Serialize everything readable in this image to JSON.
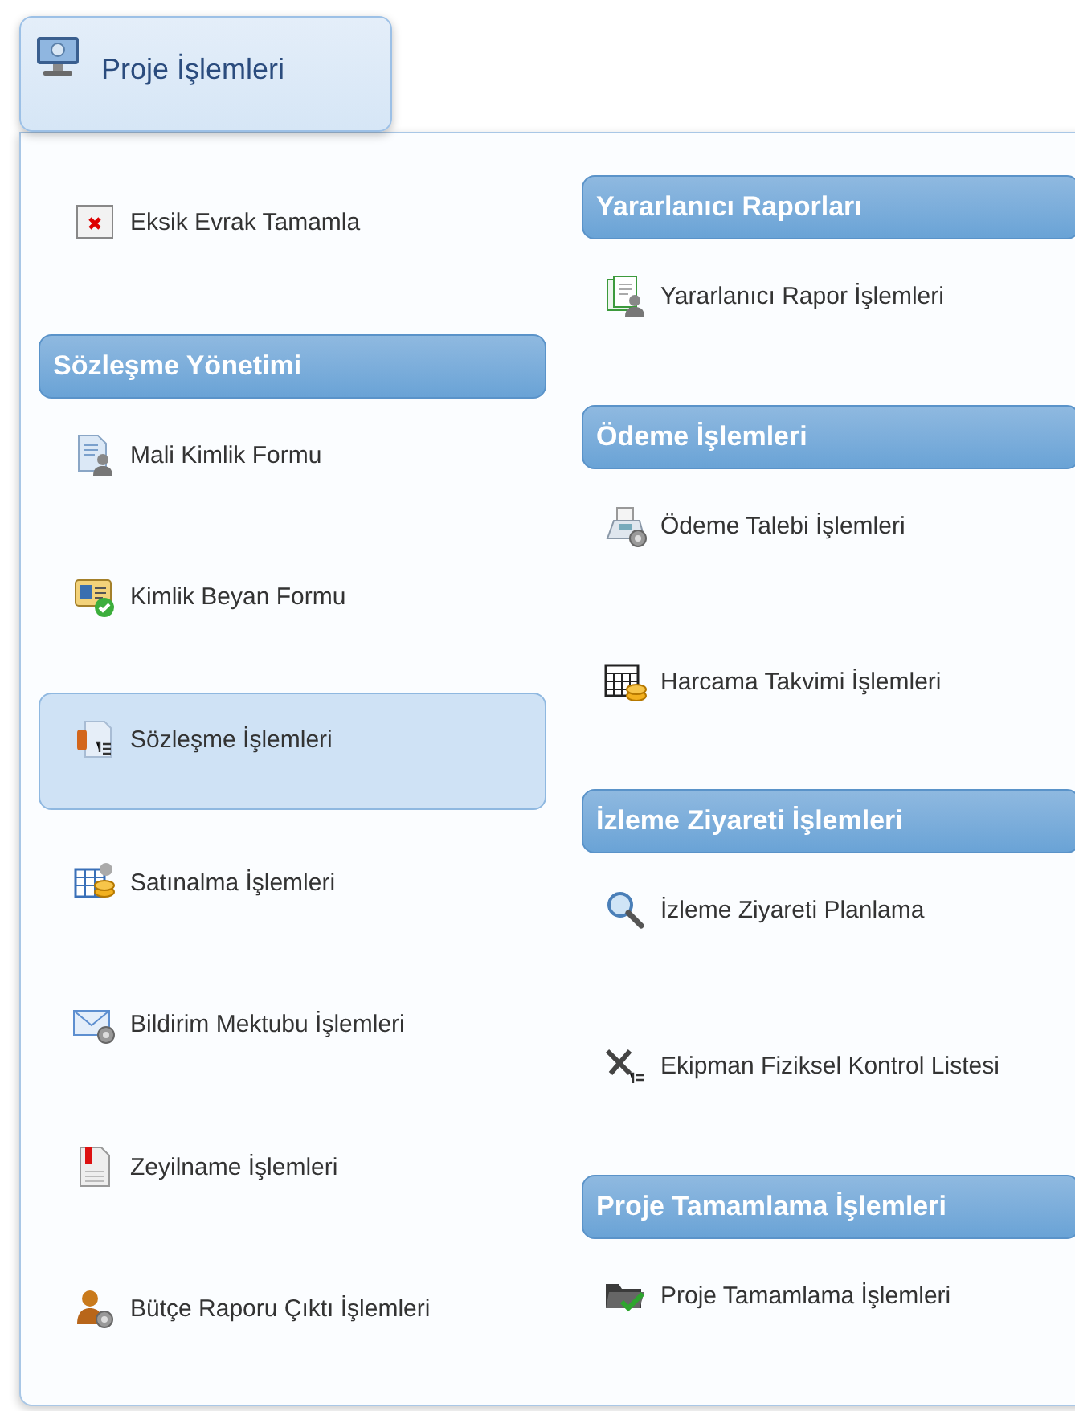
{
  "tab": {
    "label": "Proje İşlemleri"
  },
  "columns": [
    {
      "entries": [
        {
          "kind": "item",
          "label": "Eksik Evrak Tamamla",
          "selected": false
        },
        {
          "kind": "header",
          "label": "Sözleşme Yönetimi"
        },
        {
          "kind": "item",
          "label": "Mali Kimlik Formu",
          "selected": false
        },
        {
          "kind": "item",
          "label": "Kimlik Beyan Formu",
          "selected": false
        },
        {
          "kind": "item",
          "label": "Sözleşme İşlemleri",
          "selected": true
        },
        {
          "kind": "item",
          "label": "Satınalma İşlemleri",
          "selected": false
        },
        {
          "kind": "item",
          "label": "Bildirim Mektubu İşlemleri",
          "selected": false
        },
        {
          "kind": "item",
          "label": "Zeyilname İşlemleri",
          "selected": false
        },
        {
          "kind": "item",
          "label": "Bütçe Raporu Çıktı İşlemleri",
          "selected": false
        }
      ]
    },
    {
      "entries": [
        {
          "kind": "header",
          "label": "Yararlanıcı Raporları"
        },
        {
          "kind": "item",
          "label": "Yararlanıcı Rapor İşlemleri",
          "selected": false
        },
        {
          "kind": "header",
          "label": "Ödeme İşlemleri"
        },
        {
          "kind": "item",
          "label": "Ödeme Talebi İşlemleri",
          "selected": false
        },
        {
          "kind": "item",
          "label": "Harcama Takvimi İşlemleri",
          "selected": false
        },
        {
          "kind": "header",
          "label": "İzleme Ziyareti İşlemleri"
        },
        {
          "kind": "item",
          "label": "İzleme Ziyareti Planlama",
          "selected": false
        },
        {
          "kind": "item",
          "label": "Ekipman Fiziksel Kontrol Listesi",
          "selected": false
        },
        {
          "kind": "header",
          "label": "Proje Tamamlama İşlemleri"
        },
        {
          "kind": "item",
          "label": "Proje Tamamlama İşlemleri",
          "selected": false
        }
      ]
    }
  ]
}
